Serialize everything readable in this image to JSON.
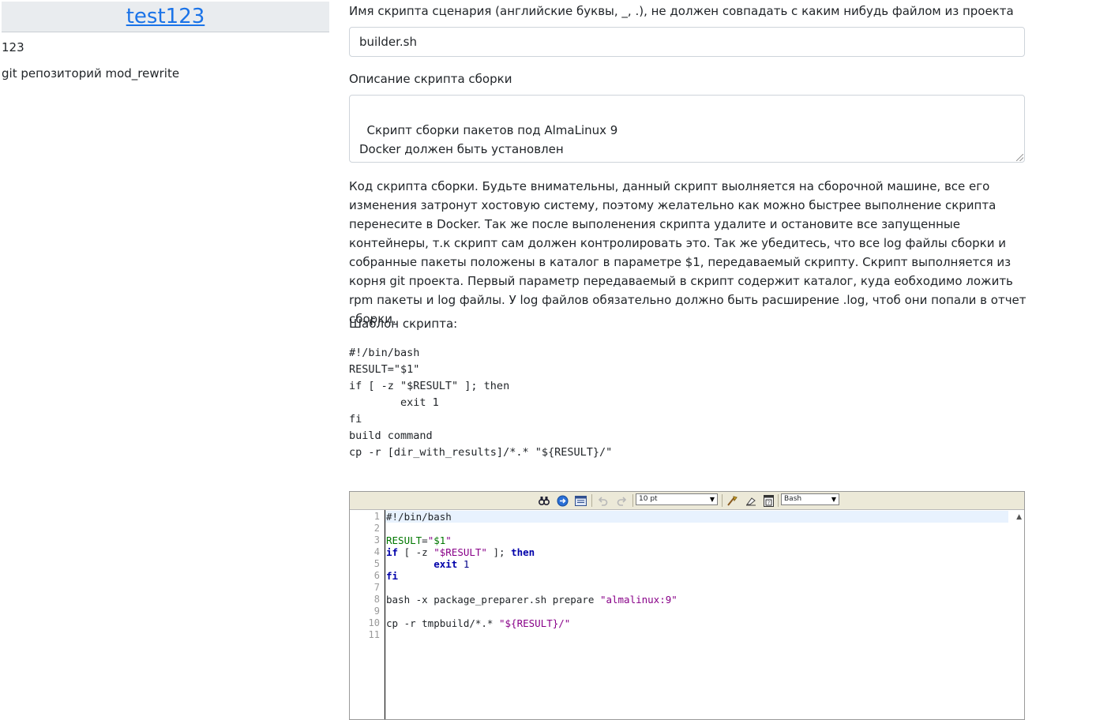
{
  "project": {
    "title": "test123",
    "description": "123",
    "repo_label": "git репозиторий mod_rewrite"
  },
  "form": {
    "name_label": "Имя скрипта сценария (английские буквы, _, .), не должен совпадать с каким нибудь файлом из проекта",
    "name_value": "builder.sh",
    "desc_label": "Описание скрипта сборки",
    "desc_value": "Скрипт сборки пакетов под AlmaLinux 9\nDocker должен быть установлен",
    "code_label": "Код скрипта сборки. Будьте внимательны, данный скрипт выолняется на сборочной машине, все его изменения затронут хостовую систему, поэтому желательно как можно быстрее выполнение скрипта перенесите в Docker. Так же после выполенения скрипта удалите и остановите все запущенные контейнеры, т.к скрипт сам должен контролировать это. Так же убедитесь, что все log файлы сборки и собранные пакеты положены в каталог в параметре $1, передаваемый скрипту. Скрипт выполняется из корня git проекта. Первый параметр передаваемый в скрипт содержит каталог, куда еобходимо ложить rpm пакеты и log файлы. У log файлов обязательно должно быть расширение .log, чтоб они попали в отчет сборки.",
    "template_label": "Шаблон скрипта:",
    "template_code": "#!/bin/bash\nRESULT=\"$1\"\nif [ -z \"$RESULT\" ]; then\n        exit 1\nfi\nbuild command\ncp -r [dir_with_results]/*.* \"${RESULT}/\""
  },
  "editor": {
    "font_size_option": "10 pt",
    "language_option": "Bash",
    "toolbar_icons": [
      "search-icon",
      "goto-line-icon",
      "fullscreen-icon",
      "undo-icon",
      "redo-icon",
      "syntax-highlight-icon",
      "reset-highlight-icon",
      "help-icon"
    ],
    "line_numbers": [
      "1",
      "2",
      "3",
      "4",
      "5",
      "6",
      "7",
      "8",
      "9",
      "10",
      "11"
    ],
    "lines": [
      "#!/bin/bash",
      "",
      "RESULT=\"$1\"",
      "if [ -z \"$RESULT\" ]; then",
      "        exit 1",
      "fi",
      "",
      "bash -x package_preparer.sh prepare \"almalinux:9\"",
      "",
      "cp -r tmpbuild/*.* \"${RESULT}/\"",
      ""
    ],
    "colors": {
      "keyword": "#0000aa",
      "variable": "#007700",
      "string": "#880088",
      "active_line": "#e8f2fe",
      "toolbar": "#ece9d8"
    }
  }
}
